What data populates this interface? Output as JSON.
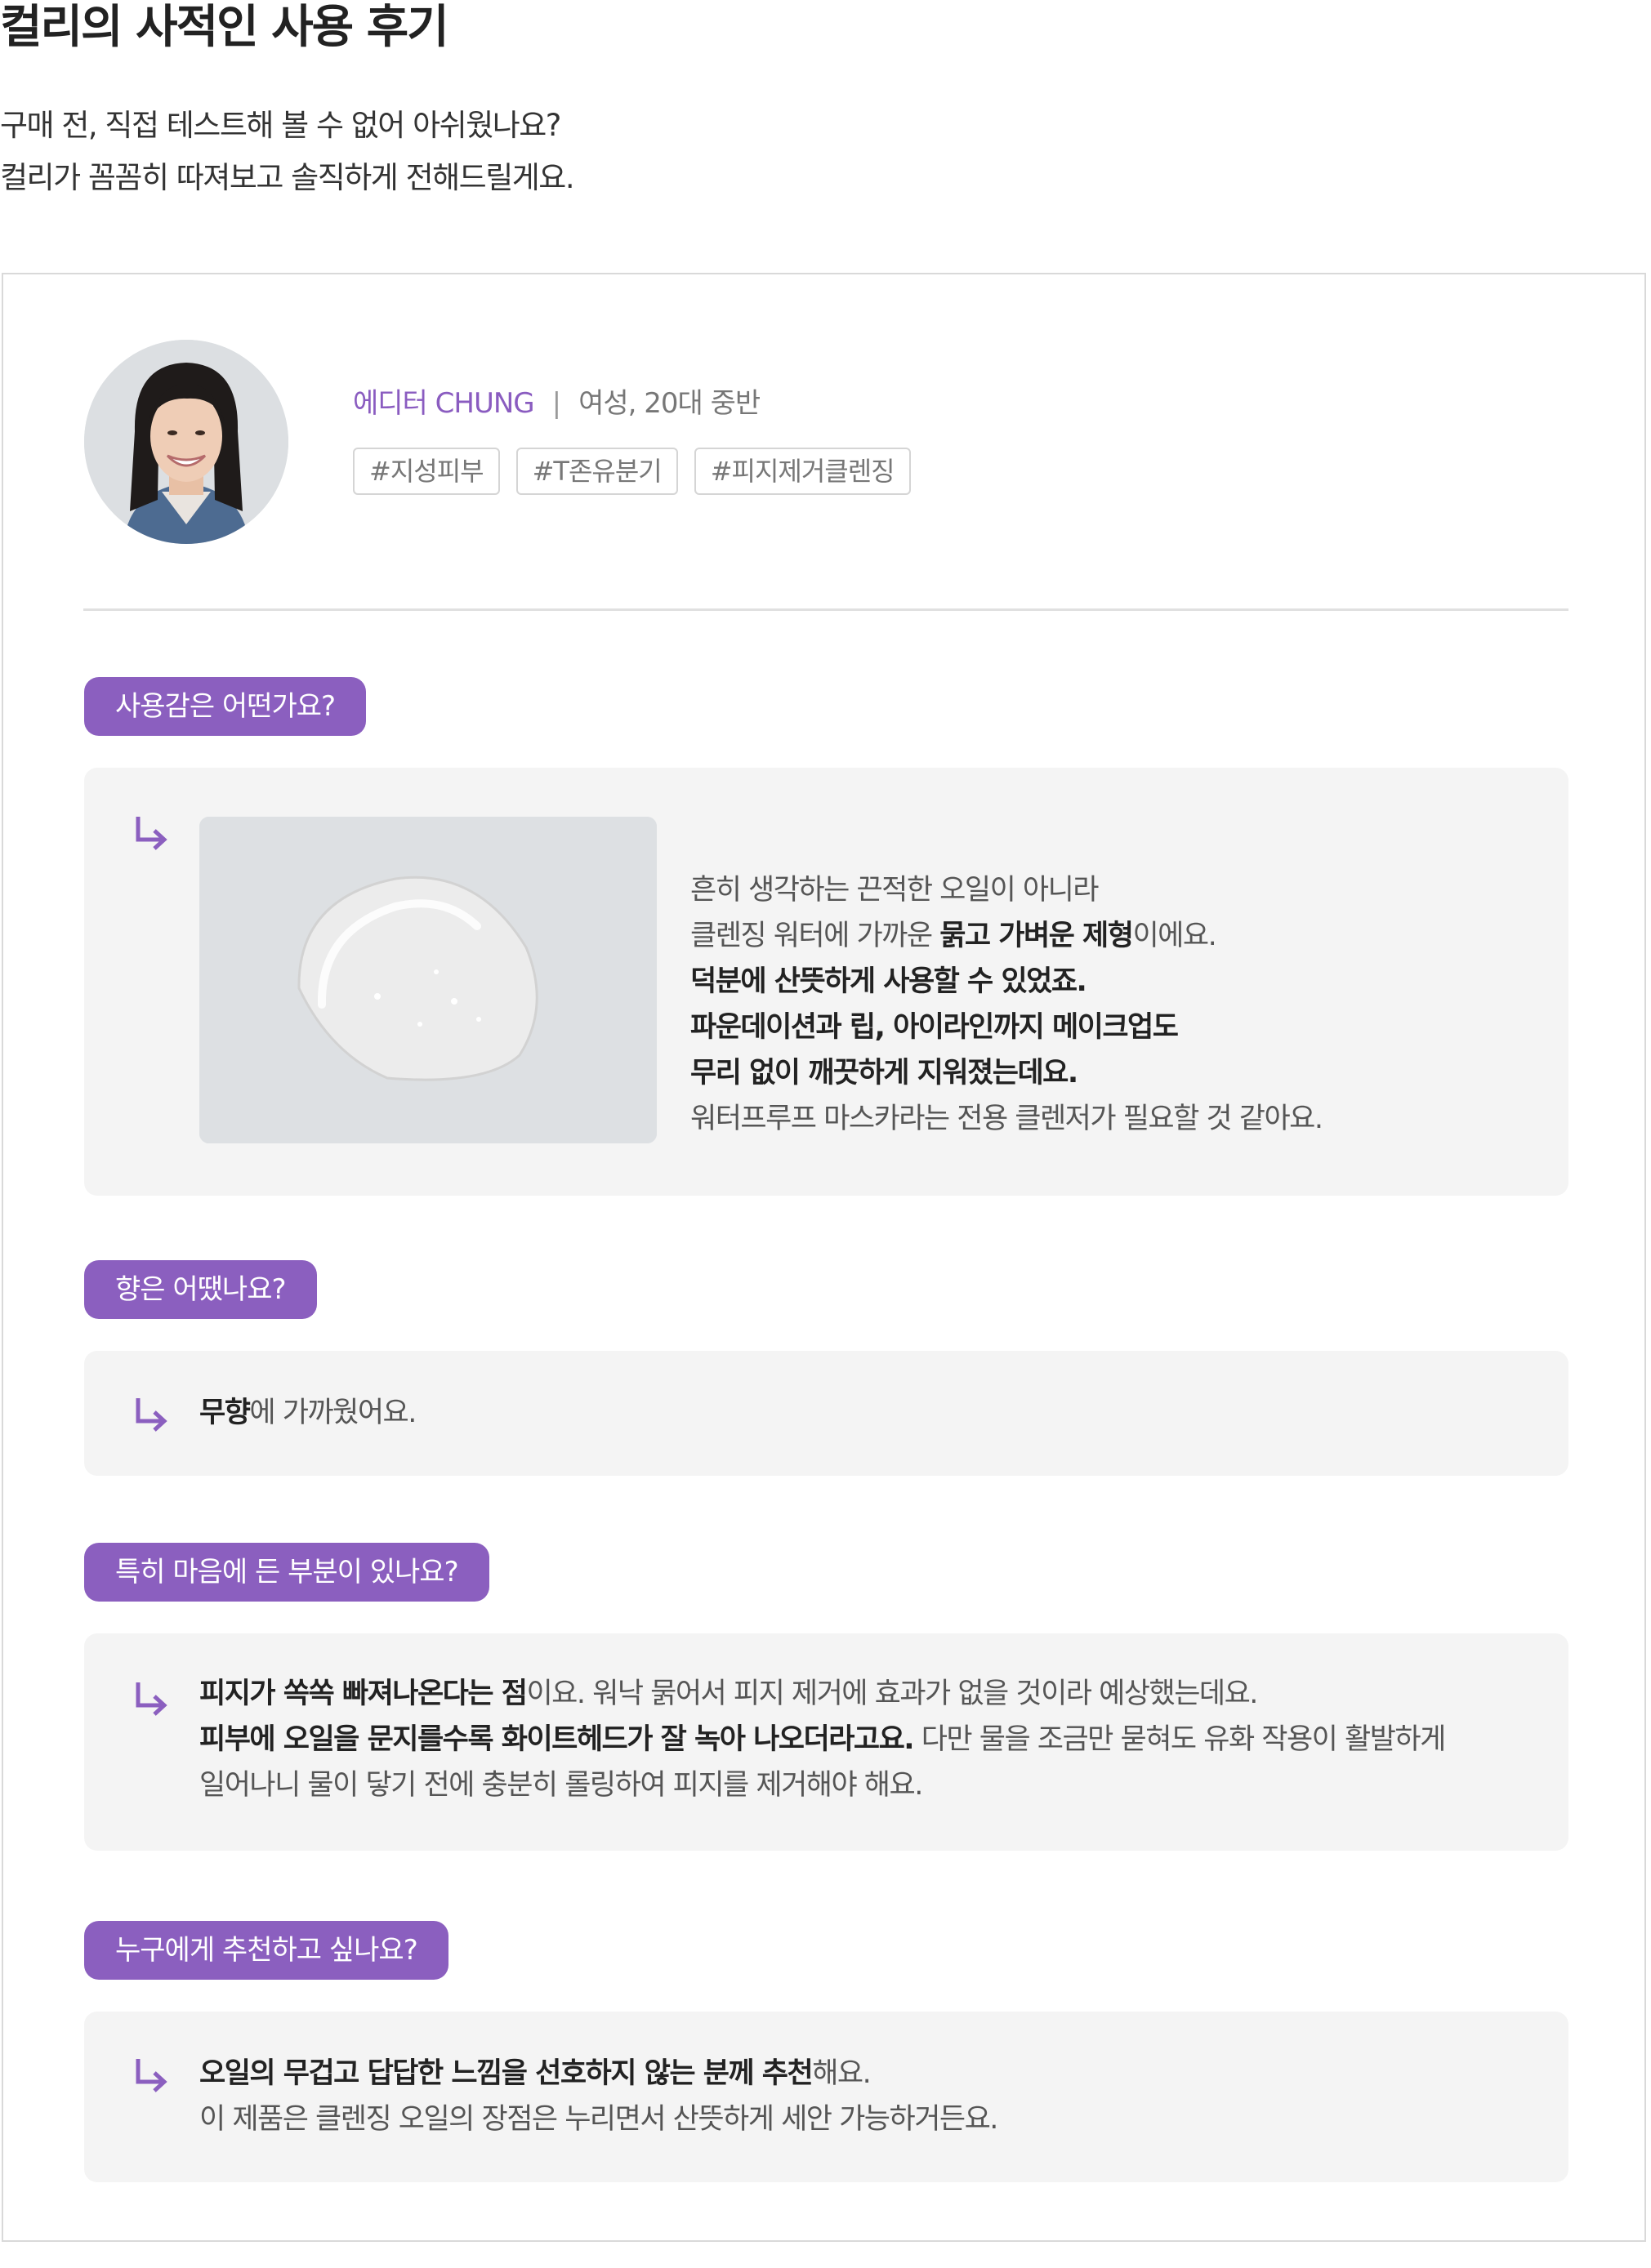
{
  "page": {
    "title": "컬리의 사적인 사용 후기",
    "intro_lines": [
      "구매 전, 직접 테스트해 볼 수 없어 아쉬웠나요?",
      "컬리가 꼼꼼히 따져보고 솔직하게 전해드릴게요."
    ]
  },
  "editor": {
    "label": "에디터 CHUNG",
    "separator": "|",
    "profile": "여성, 20대 중반",
    "tags": [
      "#지성피부",
      "#T존유분기",
      "#피지제거클렌징"
    ]
  },
  "colors": {
    "accent": "#8b5fbf",
    "panel_bg": "#f4f4f4",
    "divider": "#e0e0e0"
  },
  "sections": {
    "texture": {
      "question": "사용감은 어떤가요?",
      "lines": [
        [
          {
            "t": "흔히 생각하는 끈적한 오일이 아니라",
            "b": false
          }
        ],
        [
          {
            "t": "클렌징 워터에 가까운 ",
            "b": false
          },
          {
            "t": "묽고 가벼운 제형",
            "b": true
          },
          {
            "t": "이에요.",
            "b": false
          }
        ],
        [
          {
            "t": "덕분에 산뜻하게 사용할 수 있었죠.",
            "b": true
          }
        ],
        [
          {
            "t": "파운데이션과 립, 아이라인까지 메이크업도",
            "b": true
          }
        ],
        [
          {
            "t": "무리 없이 깨끗하게 지워졌는데요.",
            "b": true
          }
        ],
        [
          {
            "t": "워터프루프 마스카라는 전용 클렌저가 필요할 것 같아요.",
            "b": false
          }
        ]
      ]
    },
    "scent": {
      "question": "향은 어땠나요?",
      "lines": [
        [
          {
            "t": "무향",
            "b": true
          },
          {
            "t": "에 가까웠어요.",
            "b": false
          }
        ]
      ]
    },
    "favorite": {
      "question": "특히 마음에 든 부분이 있나요?",
      "lines": [
        [
          {
            "t": "피지가 쏙쏙 빠져나온다는 점",
            "b": true
          },
          {
            "t": "이요. 워낙 묽어서 피지 제거에 효과가 없을 것이라 예상했는데요.",
            "b": false
          }
        ],
        [
          {
            "t": "피부에 오일을 문지를수록 화이트헤드가 잘 녹아 나오더라고요.",
            "b": true
          },
          {
            "t": " 다만 물을 조금만 묻혀도 유화 작용이 활발하게",
            "b": false
          }
        ],
        [
          {
            "t": "일어나니 물이 닿기 전에 충분히 롤링하여 피지를 제거해야 해요.",
            "b": false
          }
        ]
      ]
    },
    "recommend": {
      "question": "누구에게 추천하고 싶나요?",
      "lines": [
        [
          {
            "t": "오일의 무겁고 답답한 느낌을 선호하지 않는 분께 추천",
            "b": true
          },
          {
            "t": "해요.",
            "b": false
          }
        ],
        [
          {
            "t": "이 제품은 클렌징 오일의 장점은 누리면서 산뜻하게 세안 가능하거든요.",
            "b": false
          }
        ]
      ]
    }
  },
  "icons": {
    "answer_arrow": "return-arrow-icon",
    "avatar": "editor-avatar",
    "product_image": "oil-texture-photo"
  }
}
